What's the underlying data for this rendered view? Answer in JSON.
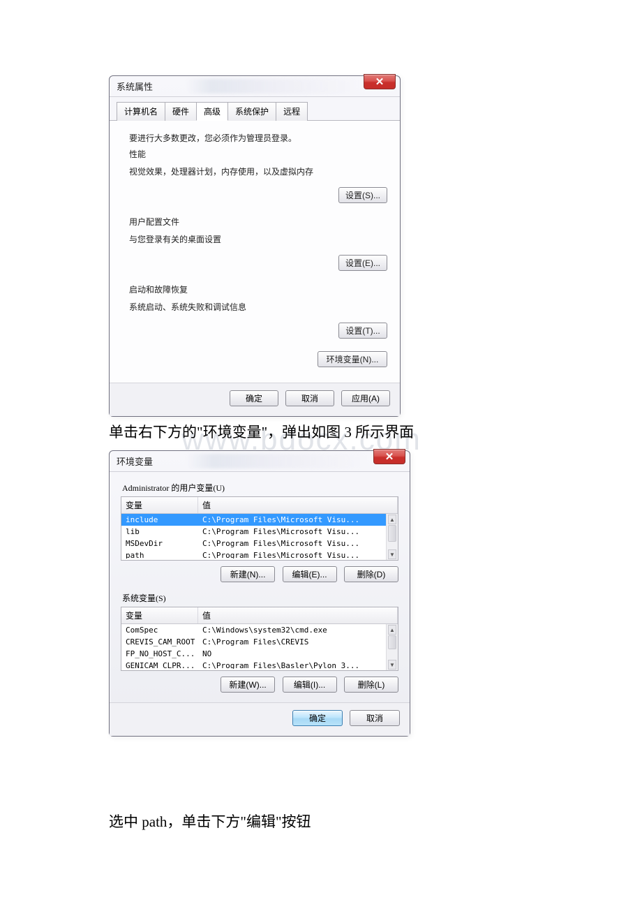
{
  "watermark": "www.bdocx.com",
  "dialog1": {
    "title": "系统属性",
    "close_x": "✕",
    "tabs": [
      "计算机名",
      "硬件",
      "高级",
      "系统保护",
      "远程"
    ],
    "active_tab_index": 2,
    "admin_note": "要进行大多数更改，您必须作为管理员登录。",
    "perf": {
      "heading": "性能",
      "desc": "视觉效果，处理器计划，内存使用，以及虚拟内存",
      "btn": "设置(S)..."
    },
    "profile": {
      "heading": "用户配置文件",
      "desc": "与您登录有关的桌面设置",
      "btn": "设置(E)..."
    },
    "startup": {
      "heading": "启动和故障恢复",
      "desc": "系统启动、系统失败和调试信息",
      "btn": "设置(T)..."
    },
    "env_btn": "环境变量(N)...",
    "ok": "确定",
    "cancel": "取消",
    "apply": "应用(A)"
  },
  "caption1": "单击右下方的\"环境变量\"，弹出如图 3 所示界面",
  "dialog2": {
    "title": "环境变量",
    "close_x": "✕",
    "user_section": "Administrator 的用户变量(U)",
    "col_var": "变量",
    "col_val": "值",
    "user_vars": [
      {
        "name": "include",
        "value": "C:\\Program Files\\Microsoft Visu..."
      },
      {
        "name": "lib",
        "value": "C:\\Program Files\\Microsoft Visu..."
      },
      {
        "name": "MSDevDir",
        "value": "C:\\Program Files\\Microsoft Visu..."
      },
      {
        "name": "path",
        "value": "C:\\Program Files\\Microsoft Visu..."
      }
    ],
    "user_btns": {
      "new": "新建(N)...",
      "edit": "编辑(E)...",
      "delete": "删除(D)"
    },
    "sys_section": "系统变量(S)",
    "sys_vars": [
      {
        "name": "ComSpec",
        "value": "C:\\Windows\\system32\\cmd.exe"
      },
      {
        "name": "CREVIS_CAM_ROOT",
        "value": "C:\\Program Files\\CREVIS"
      },
      {
        "name": "FP_NO_HOST_C...",
        "value": "NO"
      },
      {
        "name": "GENICAM_CLPR...",
        "value": "C:\\Program Files\\Basler\\Pylon 3..."
      }
    ],
    "sys_btns": {
      "new": "新建(W)...",
      "edit": "编辑(I)...",
      "delete": "删除(L)"
    },
    "ok": "确定",
    "cancel": "取消"
  },
  "caption2": "选中 path，单击下方\"编辑\"按钮"
}
